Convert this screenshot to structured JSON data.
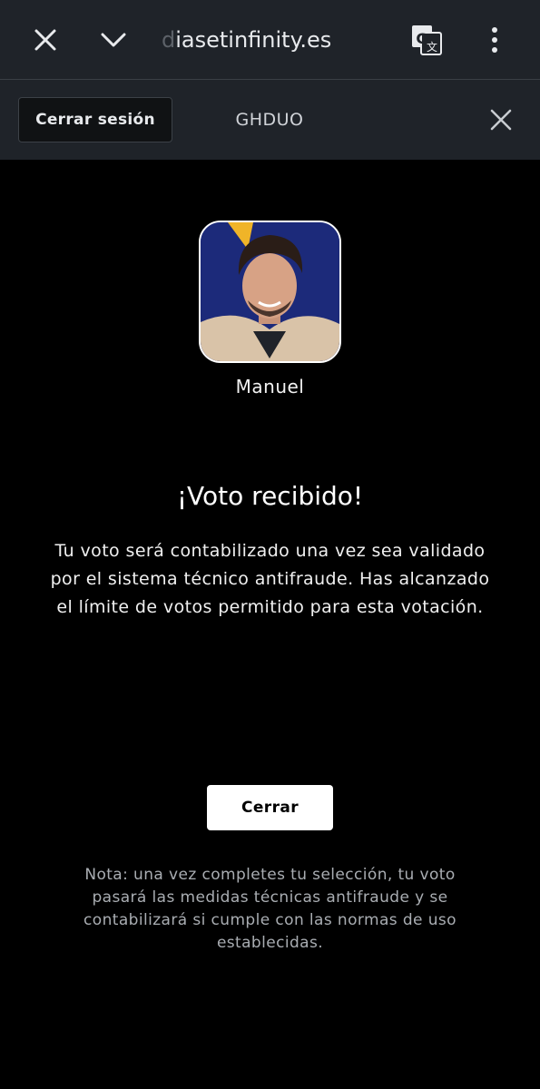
{
  "browser": {
    "url_faded": "d",
    "url": "iasetinfinity.es",
    "icons": [
      "close-icon",
      "chevron-down-icon",
      "translate-icon",
      "more-vert-icon"
    ]
  },
  "header": {
    "logout_label": "Cerrar sesión",
    "user_code": "GHDUO",
    "close_icon": "close-icon"
  },
  "candidate": {
    "name": "Manuel"
  },
  "confirmation": {
    "title": "¡Voto recibido!",
    "message": "Tu voto será contabilizado una vez sea validado por el sistema técnico antifraude. Has alcanzado el límite de votos permitido para esta votación.",
    "close_label": "Cerrar",
    "note": "Nota: una vez completes tu selección, tu voto pasará las medidas técnicas antifraude y se contabilizará si cumple con las normas de uso establecidas."
  },
  "colors": {
    "background": "#000000",
    "header": "#1f2329",
    "button": "#ffffff",
    "note_text": "#a9adb2"
  }
}
